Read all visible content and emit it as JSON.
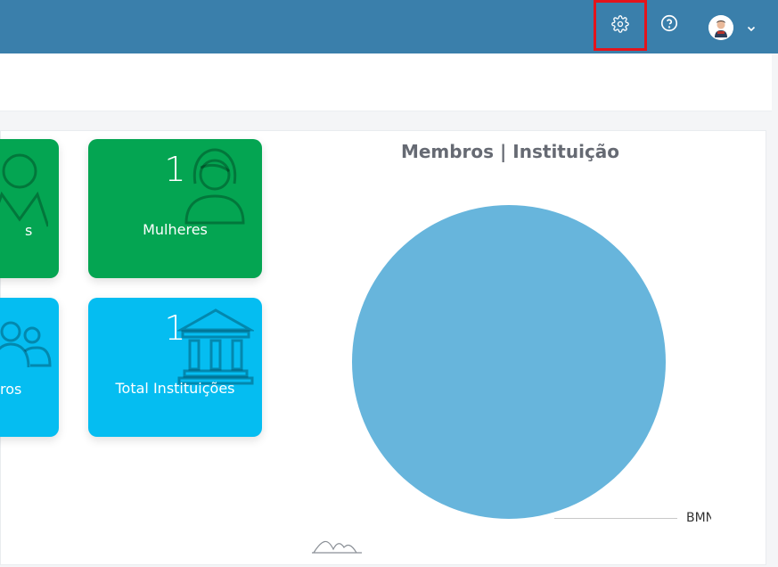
{
  "header": {
    "settings_icon": "gear-icon",
    "help_icon": "help-circle-icon",
    "avatar_icon": "user-avatar",
    "menu_icon": "chevron-down-icon"
  },
  "cards": {
    "women": {
      "count": "1",
      "label": "Mulheres",
      "icon": "woman-icon"
    },
    "men_partial": {
      "label": "s",
      "icon": "man-icon"
    },
    "members_partial": {
      "label": "ros",
      "icon": "group-icon"
    },
    "institutions": {
      "count": "1",
      "label": "Total Instituições",
      "icon": "bank-icon"
    }
  },
  "chart_data": {
    "type": "pie",
    "title": "Membros | Instituição",
    "categories": [
      "BMN"
    ],
    "values": [
      1
    ],
    "colors": [
      "#67b5dc"
    ],
    "visible_label": "BMN"
  },
  "colors": {
    "topbar": "#3a7fab",
    "green": "#04a552",
    "cyan": "#05bdf1",
    "highlight": "#e3141c"
  }
}
